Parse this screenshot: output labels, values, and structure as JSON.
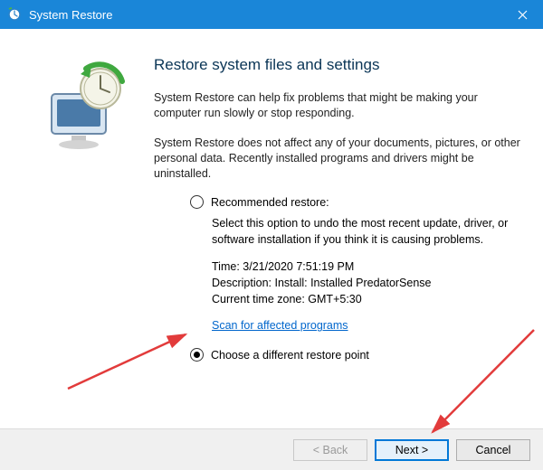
{
  "window": {
    "title": "System Restore",
    "close_label": "Close"
  },
  "heading": "Restore system files and settings",
  "para1": "System Restore can help fix problems that might be making your computer run slowly or stop responding.",
  "para2": "System Restore does not affect any of your documents, pictures, or other personal data. Recently installed programs and drivers might be uninstalled.",
  "option1": {
    "label": "Recommended restore:",
    "desc": "Select this option to undo the most recent update, driver, or software installation if you think it is causing problems.",
    "time_label": "Time: ",
    "time_value": "3/21/2020 7:51:19 PM",
    "desc_label": "Description: ",
    "desc_value": "Install: Installed PredatorSense",
    "tz_label": "Current time zone: ",
    "tz_value": "GMT+5:30",
    "scan_link": "Scan for affected programs"
  },
  "option2": {
    "label": "Choose a different restore point"
  },
  "footer": {
    "back": "< Back",
    "next": "Next >",
    "cancel": "Cancel"
  }
}
